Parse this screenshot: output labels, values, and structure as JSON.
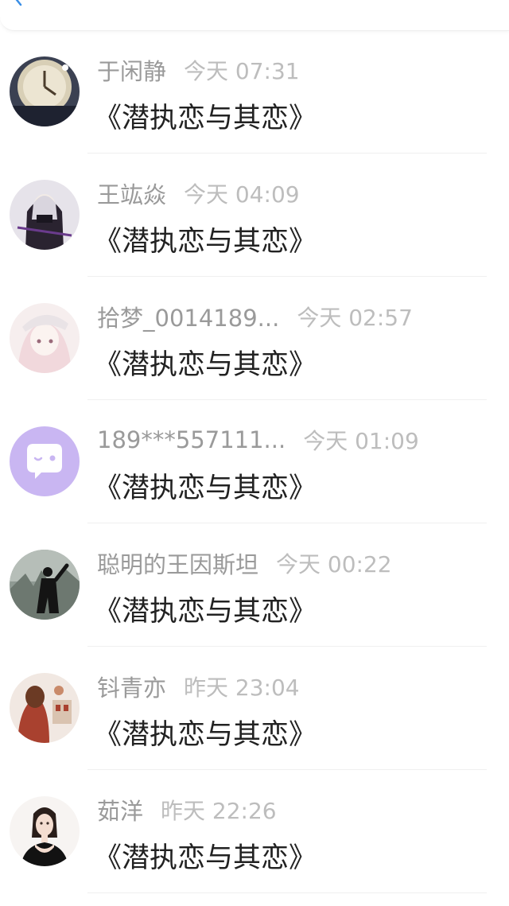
{
  "messages": [
    {
      "name": "于闲静",
      "time": "今天 07:31",
      "text": "《潜执恋与其恋》",
      "avatar": "clock-avatar"
    },
    {
      "name": "王竑焱",
      "time": "今天 04:09",
      "text": "《潜执恋与其恋》",
      "avatar": "anime-dark-avatar"
    },
    {
      "name": "拾梦_0014189...",
      "time": "今天 02:57",
      "text": "《潜执恋与其恋》",
      "avatar": "anime-girl-avatar"
    },
    {
      "name": "189***557111...",
      "time": "今天 01:09",
      "text": "《潜执恋与其恋》",
      "avatar": "chat-bubble-avatar"
    },
    {
      "name": "聪明的王因斯坦",
      "time": "今天 00:22",
      "text": "《潜执恋与其恋》",
      "avatar": "silhouette-avatar"
    },
    {
      "name": "钭青亦",
      "time": "昨天 23:04",
      "text": "《潜执恋与其恋》",
      "avatar": "illustration-avatar"
    },
    {
      "name": "茹洋",
      "time": "昨天 22:26",
      "text": "《潜执恋与其恋》",
      "avatar": "woman-portrait-avatar"
    }
  ],
  "colors": {
    "accent": "#3a8ee6",
    "name": "#9a9a9a",
    "time": "#bdbdbd",
    "text": "#222222",
    "chat_avatar_bg": "#c9b6f2"
  }
}
